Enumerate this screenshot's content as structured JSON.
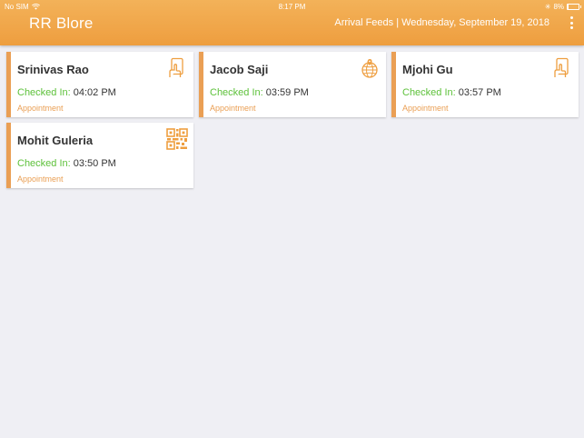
{
  "status_bar": {
    "carrier": "No SIM",
    "time": "8:17 PM",
    "battery_text": "8%",
    "battery_level": 0.08
  },
  "header": {
    "title": "RR Blore",
    "subtitle": "Arrival Feeds | Wednesday, September 19, 2018"
  },
  "colors": {
    "accent": "#ee9e3f",
    "checked_in": "#5dc13a",
    "type_text": "#ea9f54"
  },
  "cards": [
    {
      "name": "Srinivas Rao",
      "checkin_label": "Checked In:",
      "checkin_time": "04:02 PM",
      "type": "Appointment",
      "icon": "tap-device-icon"
    },
    {
      "name": "Jacob Saji",
      "checkin_label": "Checked In:",
      "checkin_time": "03:59 PM",
      "type": "Appointment",
      "icon": "globe-location-icon"
    },
    {
      "name": "Mjohi Gu",
      "checkin_label": "Checked In:",
      "checkin_time": "03:57 PM",
      "type": "Appointment",
      "icon": "tap-device-icon"
    },
    {
      "name": "Mohit Guleria",
      "checkin_label": "Checked In:",
      "checkin_time": "03:50 PM",
      "type": "Appointment",
      "icon": "qr-code-icon"
    }
  ]
}
